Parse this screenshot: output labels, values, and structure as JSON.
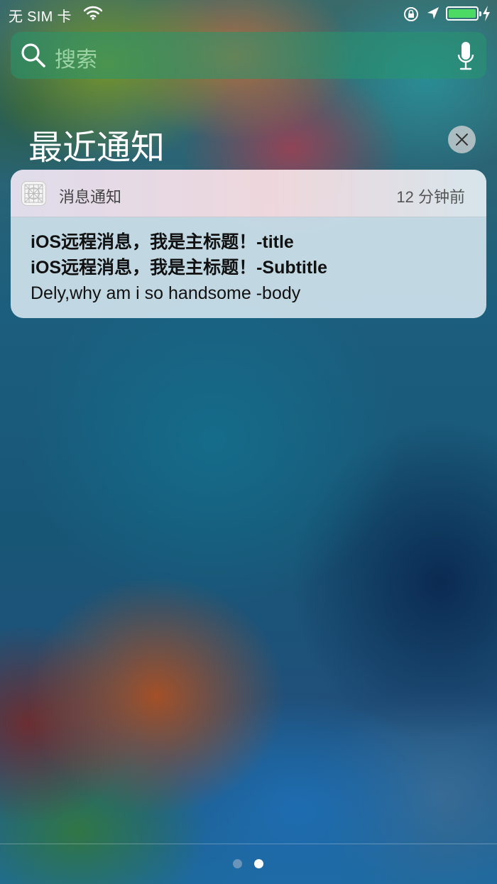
{
  "status_bar": {
    "carrier": "无 SIM 卡",
    "battery_level": 1.0,
    "battery_color": "#4cd964"
  },
  "search": {
    "placeholder": "搜索",
    "icons": [
      "search-icon",
      "microphone-icon"
    ]
  },
  "recent_notifications": {
    "title": "最近通知",
    "clear_icon": "close-icon"
  },
  "notification": {
    "app_name": "消息通知",
    "time": "12 分钟前",
    "title": "iOS远程消息，我是主标题！-title",
    "subtitle": "iOS远程消息，我是主标题！-Subtitle",
    "body": "Dely,why am i so handsome -body"
  },
  "page_indicator": {
    "count": 2,
    "active_index": 1
  }
}
